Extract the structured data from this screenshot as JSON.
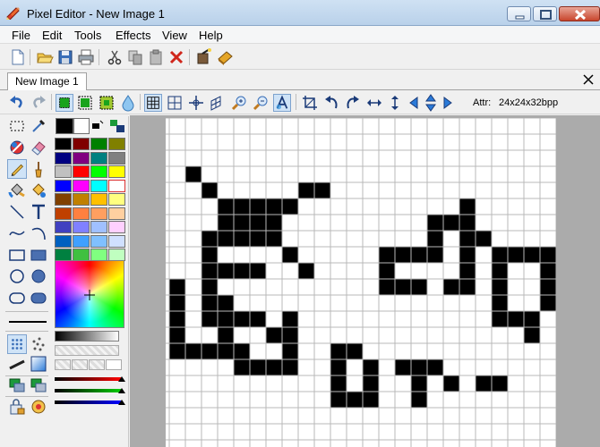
{
  "window": {
    "title": "Pixel Editor - New Image 1"
  },
  "menu": [
    "File",
    "Edit",
    "Tools",
    "Effects",
    "View",
    "Help"
  ],
  "toolbar_icons": [
    "new-file",
    "open-folder",
    "save",
    "print",
    "cut",
    "copy",
    "paste",
    "delete",
    "effects-wand",
    "book"
  ],
  "document_tab": {
    "label": "New Image 1"
  },
  "image_toolbar": {
    "icons": [
      "undo",
      "redo",
      "select-all",
      "select-invert",
      "select-color",
      "transparency-drop",
      "grid",
      "grid-fine",
      "crosshair",
      "perspective-grid",
      "zoom-in",
      "zoom-out",
      "text-antialias",
      "crop",
      "rotate-left",
      "rotate-right",
      "flip-horizontal",
      "flip-vertical",
      "shift-left",
      "shift-up-down",
      "shift-right"
    ],
    "attr_label": "Attr:",
    "attr_value": "24x24x32bpp"
  },
  "tools": [
    "rectangle-select",
    "eyedropper",
    "color-replace",
    "eraser",
    "pencil",
    "brush",
    "fill-bucket",
    "fill-gradient",
    "line",
    "text",
    "curve",
    "arc",
    "rectangle-outline",
    "rectangle-filled",
    "ellipse-outline",
    "ellipse-filled",
    "roundrect-outline",
    "roundrect-filled",
    "line-width",
    "spray",
    "spray-dots",
    "pen-thin",
    "gradient-box",
    "layer-copy",
    "layer-merge",
    "lock",
    "eye-lock"
  ],
  "palette": {
    "primary": "#000000",
    "secondary": "#ffffff",
    "swatches": [
      [
        "#000000",
        "#800000",
        "#008000",
        "#808000"
      ],
      [
        "#000080",
        "#800080",
        "#008080",
        "#808080"
      ],
      [
        "#c0c0c0",
        "#ff0000",
        "#00ff00",
        "#ffff00"
      ],
      [
        "#0000ff",
        "#ff00ff",
        "#00ffff",
        "#ffffff"
      ],
      [
        "#804000",
        "#c08000",
        "#ffc000",
        "#ffff80"
      ],
      [
        "#c04000",
        "#ff8040",
        "#ff9f60",
        "#ffd0a0"
      ],
      [
        "#4040c0",
        "#8080ff",
        "#a0c0ff",
        "#ffd0ff"
      ],
      [
        "#0060c0",
        "#40a0ff",
        "#80c0ff",
        "#d0e0ff"
      ],
      [
        "#008040",
        "#40c040",
        "#80ff80",
        "#c0ffc0"
      ]
    ]
  },
  "canvas": {
    "grid_color": "#b8b8b8",
    "pixel_color": "#000000",
    "filled_pixels": [
      [
        1,
        3
      ],
      [
        2,
        4
      ],
      [
        3,
        5
      ],
      [
        4,
        5
      ],
      [
        5,
        6
      ],
      [
        6,
        7
      ],
      [
        7,
        8
      ],
      [
        8,
        9
      ],
      [
        6,
        6
      ],
      [
        7,
        5
      ],
      [
        8,
        4
      ],
      [
        9,
        4
      ],
      [
        3,
        6
      ],
      [
        4,
        6
      ],
      [
        5,
        5
      ],
      [
        6,
        5
      ],
      [
        2,
        7
      ],
      [
        3,
        7
      ],
      [
        4,
        7
      ],
      [
        5,
        7
      ],
      [
        6,
        7
      ],
      [
        2,
        8
      ],
      [
        2,
        9
      ],
      [
        3,
        9
      ],
      [
        4,
        9
      ],
      [
        5,
        9
      ],
      [
        0,
        10
      ],
      [
        0,
        11
      ],
      [
        0,
        12
      ],
      [
        0,
        13
      ],
      [
        0,
        14
      ],
      [
        1,
        14
      ],
      [
        2,
        14
      ],
      [
        2,
        10
      ],
      [
        2,
        11
      ],
      [
        3,
        11
      ],
      [
        2,
        12
      ],
      [
        3,
        12
      ],
      [
        4,
        12
      ],
      [
        5,
        12
      ],
      [
        3,
        13
      ],
      [
        3,
        14
      ],
      [
        4,
        14
      ],
      [
        4,
        15
      ],
      [
        5,
        15
      ],
      [
        6,
        15
      ],
      [
        7,
        15
      ],
      [
        6,
        13
      ],
      [
        7,
        13
      ],
      [
        7,
        12
      ],
      [
        7,
        14
      ],
      [
        10,
        14
      ],
      [
        11,
        14
      ],
      [
        10,
        15
      ],
      [
        10,
        16
      ],
      [
        10,
        17
      ],
      [
        11,
        17
      ],
      [
        12,
        15
      ],
      [
        12,
        16
      ],
      [
        12,
        17
      ],
      [
        14,
        15
      ],
      [
        15,
        15
      ],
      [
        16,
        15
      ],
      [
        15,
        16
      ],
      [
        15,
        17
      ],
      [
        17,
        16
      ],
      [
        19,
        16
      ],
      [
        20,
        16
      ],
      [
        13,
        8
      ],
      [
        13,
        9
      ],
      [
        13,
        10
      ],
      [
        14,
        10
      ],
      [
        15,
        10
      ],
      [
        14,
        8
      ],
      [
        15,
        8
      ],
      [
        16,
        8
      ],
      [
        16,
        7
      ],
      [
        16,
        6
      ],
      [
        17,
        6
      ],
      [
        18,
        5
      ],
      [
        18,
        6
      ],
      [
        18,
        7
      ],
      [
        19,
        7
      ],
      [
        18,
        8
      ],
      [
        18,
        9
      ],
      [
        18,
        10
      ],
      [
        17,
        10
      ],
      [
        20,
        8
      ],
      [
        21,
        8
      ],
      [
        22,
        8
      ],
      [
        23,
        8
      ],
      [
        20,
        9
      ],
      [
        20,
        10
      ],
      [
        20,
        11
      ],
      [
        20,
        12
      ],
      [
        21,
        12
      ],
      [
        22,
        12
      ],
      [
        23,
        11
      ],
      [
        23,
        10
      ],
      [
        23,
        9
      ],
      [
        22,
        13
      ]
    ]
  }
}
